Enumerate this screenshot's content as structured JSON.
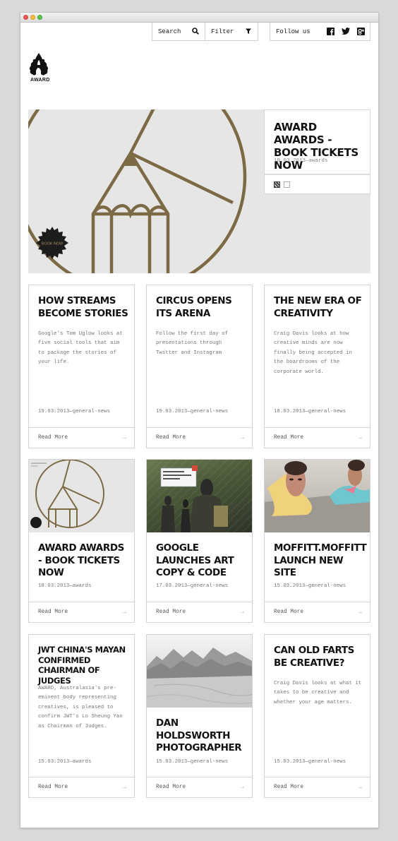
{
  "header": {
    "search_label": "Search",
    "filter_label": "Filter",
    "follow_label": "Follow us",
    "social_icons": [
      "facebook-icon",
      "twitter-icon",
      "google-plus-icon"
    ]
  },
  "logo": {
    "text": "AWARD"
  },
  "hero": {
    "title": "AWARD AWARDS - BOOK TICKETS NOW",
    "meta": "18.03.2013—awards",
    "badge": "BOOK NOW",
    "accent_color": "#7c6a45",
    "slides_total": 2,
    "slide_active": 1
  },
  "cards": [
    {
      "title": "HOW STREAMS BECOME STORIES",
      "desc": "Google's Tom Uglow looks at five social tools that aim to package the stories of your life.",
      "meta": "19.03.2013—general-news",
      "cta": "Read More"
    },
    {
      "title": "CIRCUS OPENS ITS ARENA",
      "desc": "Follow the first day of presentations through Twitter and Instagram",
      "meta": "19.03.2013—general-news",
      "cta": "Read More"
    },
    {
      "title": "THE NEW ERA OF CREATIVITY",
      "desc": "Craig Davis looks at how creative minds are now finally being accepted in the boardrooms of the corporate world.",
      "meta": "18.03.2013—general-news",
      "cta": "Read More"
    },
    {
      "title": "AWARD AWARDS - BOOK TICKETS NOW",
      "meta": "18.03.2013—awards",
      "cta": "Read More"
    },
    {
      "title": "GOOGLE LAUNCHES ART COPY & CODE",
      "meta": "17.03.2013—general-news",
      "cta": "Read More"
    },
    {
      "title": "MOFFITT.MOFFITT LAUNCH NEW SITE",
      "meta": "15.03.2013—general-news",
      "cta": "Read More"
    },
    {
      "title": "JWT CHINA'S MAYAN CONFIRMED CHAIRMAN OF JUDGES",
      "desc": "AWARD, Australasia's pre-eminent body representing creatives, is pleased to confirm JWT's Lo Sheung Yan as Chairman of Judges.",
      "meta": "15.03.2013—awards",
      "cta": "Read More"
    },
    {
      "title": "DAN HOLDSWORTH PHOTOGRAPHER",
      "meta": "15.03.2013—general-news",
      "cta": "Read More"
    },
    {
      "title": "CAN OLD FARTS BE CREATIVE?",
      "desc": "Craig Davis looks at what it takes to be creative and whether your age matters.",
      "meta": "15.03.2013—general-news",
      "cta": "Read More"
    }
  ]
}
